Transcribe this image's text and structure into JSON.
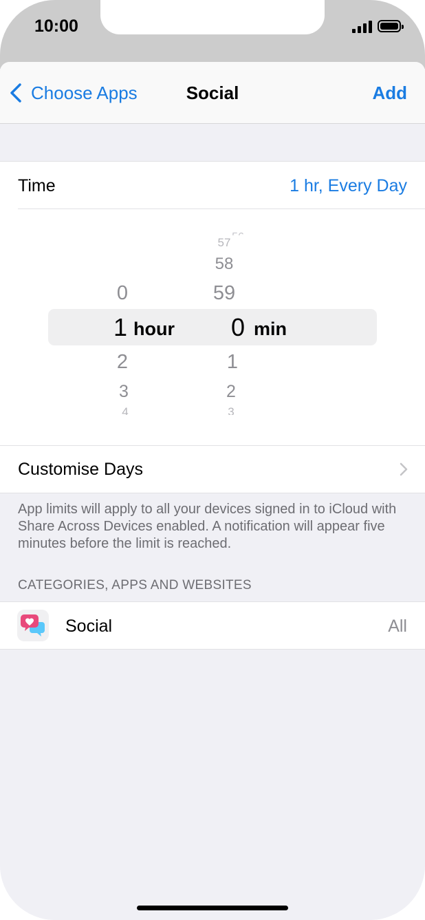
{
  "status_bar": {
    "time": "10:00"
  },
  "navbar": {
    "back_label": "Choose Apps",
    "title": "Social",
    "add_label": "Add"
  },
  "time_row": {
    "label": "Time",
    "value": "1 hr, Every Day"
  },
  "picker": {
    "hours_above": [
      "0"
    ],
    "hours_selected": "1",
    "hours_unit": "hour",
    "hours_below": [
      "2",
      "3",
      "4"
    ],
    "minutes_above": [
      "57",
      "58",
      "59"
    ],
    "minutes_selected": "0",
    "minutes_unit": "min",
    "minutes_below": [
      "1",
      "2",
      "3"
    ]
  },
  "customise_row": {
    "label": "Customise Days"
  },
  "footer_note": "App limits will apply to all your devices signed in to iCloud with Share Across Devices enabled. A notification will appear five minutes before the limit is reached.",
  "section_header": "CATEGORIES, APPS AND WEBSITES",
  "social_row": {
    "label": "Social",
    "value": "All",
    "icon": "social-category-icon"
  },
  "colors": {
    "accent": "#1a7ce2",
    "background": "#f0f0f5",
    "status_bar": "#cccccc"
  }
}
